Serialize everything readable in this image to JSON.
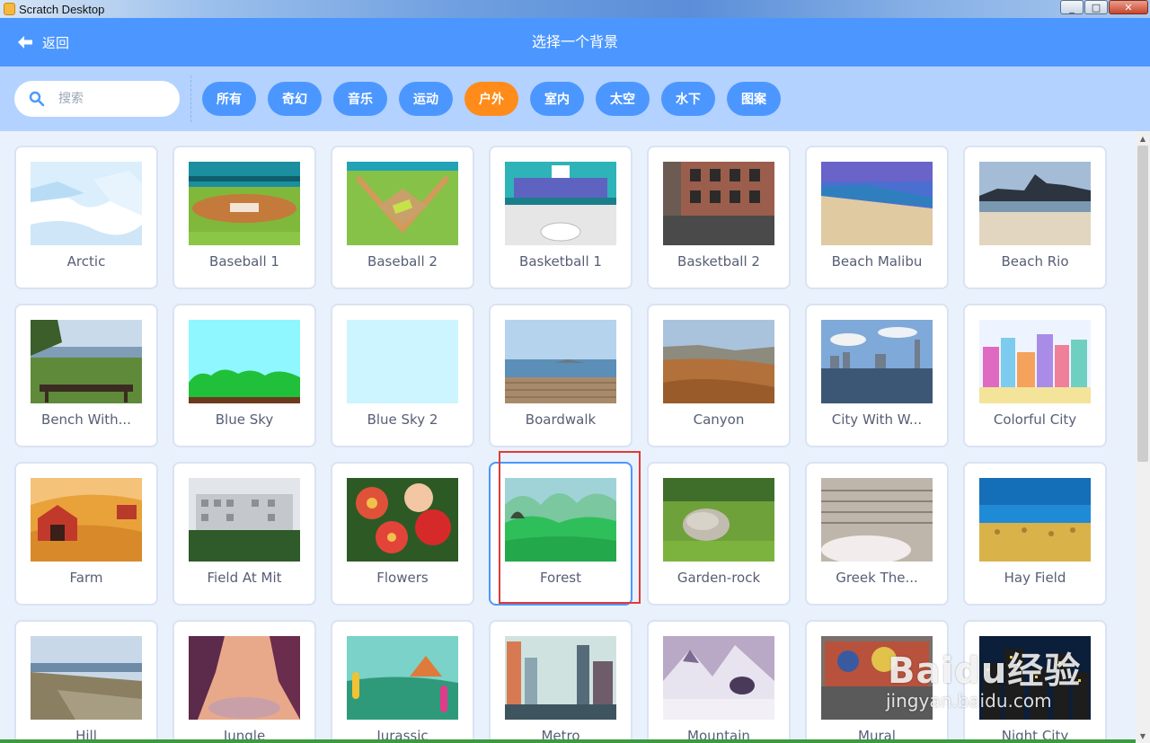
{
  "window": {
    "title": "Scratch Desktop",
    "minimize": "_",
    "maximize": "□",
    "close": "✕"
  },
  "header": {
    "back_label": "返回",
    "title": "选择一个背景"
  },
  "search": {
    "placeholder": "搜索",
    "value": ""
  },
  "tags": [
    {
      "label": "所有",
      "active": false
    },
    {
      "label": "奇幻",
      "active": false
    },
    {
      "label": "音乐",
      "active": false
    },
    {
      "label": "运动",
      "active": false
    },
    {
      "label": "户外",
      "active": true
    },
    {
      "label": "室内",
      "active": false
    },
    {
      "label": "太空",
      "active": false
    },
    {
      "label": "水下",
      "active": false
    },
    {
      "label": "图案",
      "active": false
    }
  ],
  "backdrops": [
    {
      "name": "Arctic"
    },
    {
      "name": "Baseball 1"
    },
    {
      "name": "Baseball 2"
    },
    {
      "name": "Basketball 1"
    },
    {
      "name": "Basketball 2"
    },
    {
      "name": "Beach Malibu"
    },
    {
      "name": "Beach Rio"
    },
    {
      "name": "Bench With..."
    },
    {
      "name": "Blue Sky"
    },
    {
      "name": "Blue Sky 2"
    },
    {
      "name": "Boardwalk"
    },
    {
      "name": "Canyon"
    },
    {
      "name": "City With W..."
    },
    {
      "name": "Colorful City"
    },
    {
      "name": "Farm"
    },
    {
      "name": "Field At Mit"
    },
    {
      "name": "Flowers"
    },
    {
      "name": "Forest",
      "selected": true
    },
    {
      "name": "Garden-rock"
    },
    {
      "name": "Greek The..."
    },
    {
      "name": "Hay Field"
    },
    {
      "name": "Hill"
    },
    {
      "name": "Jungle"
    },
    {
      "name": "Jurassic"
    },
    {
      "name": "Metro"
    },
    {
      "name": "Mountain"
    },
    {
      "name": "Mural"
    },
    {
      "name": "Night City"
    }
  ],
  "watermark": {
    "line1": "Baidu经验",
    "line2": "jingyan.baidu.com"
  },
  "colors": {
    "header": "#4c97ff",
    "filterbar": "#b3d2ff",
    "tag": "#4c97ff",
    "tag_active": "#ff8c1a",
    "annotation": "#e23a3a"
  }
}
